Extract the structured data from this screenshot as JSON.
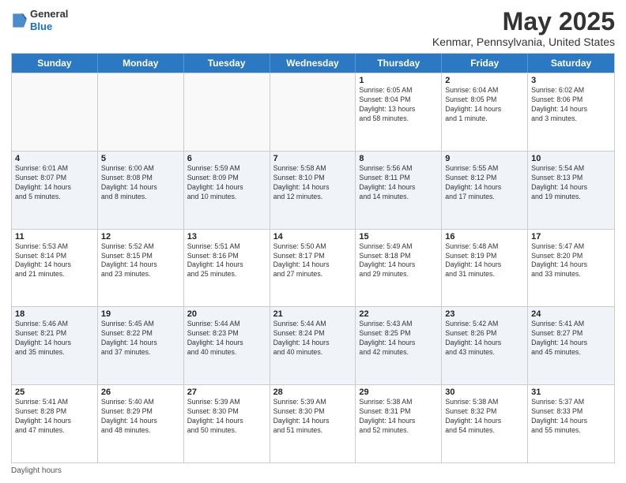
{
  "logo": {
    "general": "General",
    "blue": "Blue"
  },
  "title": "May 2025",
  "subtitle": "Kenmar, Pennsylvania, United States",
  "days": [
    "Sunday",
    "Monday",
    "Tuesday",
    "Wednesday",
    "Thursday",
    "Friday",
    "Saturday"
  ],
  "footer": "Daylight hours",
  "weeks": [
    [
      {
        "date": "",
        "info": ""
      },
      {
        "date": "",
        "info": ""
      },
      {
        "date": "",
        "info": ""
      },
      {
        "date": "",
        "info": ""
      },
      {
        "date": "1",
        "info": "Sunrise: 6:05 AM\nSunset: 8:04 PM\nDaylight: 13 hours\nand 58 minutes."
      },
      {
        "date": "2",
        "info": "Sunrise: 6:04 AM\nSunset: 8:05 PM\nDaylight: 14 hours\nand 1 minute."
      },
      {
        "date": "3",
        "info": "Sunrise: 6:02 AM\nSunset: 8:06 PM\nDaylight: 14 hours\nand 3 minutes."
      }
    ],
    [
      {
        "date": "4",
        "info": "Sunrise: 6:01 AM\nSunset: 8:07 PM\nDaylight: 14 hours\nand 5 minutes."
      },
      {
        "date": "5",
        "info": "Sunrise: 6:00 AM\nSunset: 8:08 PM\nDaylight: 14 hours\nand 8 minutes."
      },
      {
        "date": "6",
        "info": "Sunrise: 5:59 AM\nSunset: 8:09 PM\nDaylight: 14 hours\nand 10 minutes."
      },
      {
        "date": "7",
        "info": "Sunrise: 5:58 AM\nSunset: 8:10 PM\nDaylight: 14 hours\nand 12 minutes."
      },
      {
        "date": "8",
        "info": "Sunrise: 5:56 AM\nSunset: 8:11 PM\nDaylight: 14 hours\nand 14 minutes."
      },
      {
        "date": "9",
        "info": "Sunrise: 5:55 AM\nSunset: 8:12 PM\nDaylight: 14 hours\nand 17 minutes."
      },
      {
        "date": "10",
        "info": "Sunrise: 5:54 AM\nSunset: 8:13 PM\nDaylight: 14 hours\nand 19 minutes."
      }
    ],
    [
      {
        "date": "11",
        "info": "Sunrise: 5:53 AM\nSunset: 8:14 PM\nDaylight: 14 hours\nand 21 minutes."
      },
      {
        "date": "12",
        "info": "Sunrise: 5:52 AM\nSunset: 8:15 PM\nDaylight: 14 hours\nand 23 minutes."
      },
      {
        "date": "13",
        "info": "Sunrise: 5:51 AM\nSunset: 8:16 PM\nDaylight: 14 hours\nand 25 minutes."
      },
      {
        "date": "14",
        "info": "Sunrise: 5:50 AM\nSunset: 8:17 PM\nDaylight: 14 hours\nand 27 minutes."
      },
      {
        "date": "15",
        "info": "Sunrise: 5:49 AM\nSunset: 8:18 PM\nDaylight: 14 hours\nand 29 minutes."
      },
      {
        "date": "16",
        "info": "Sunrise: 5:48 AM\nSunset: 8:19 PM\nDaylight: 14 hours\nand 31 minutes."
      },
      {
        "date": "17",
        "info": "Sunrise: 5:47 AM\nSunset: 8:20 PM\nDaylight: 14 hours\nand 33 minutes."
      }
    ],
    [
      {
        "date": "18",
        "info": "Sunrise: 5:46 AM\nSunset: 8:21 PM\nDaylight: 14 hours\nand 35 minutes."
      },
      {
        "date": "19",
        "info": "Sunrise: 5:45 AM\nSunset: 8:22 PM\nDaylight: 14 hours\nand 37 minutes."
      },
      {
        "date": "20",
        "info": "Sunrise: 5:44 AM\nSunset: 8:23 PM\nDaylight: 14 hours\nand 40 minutes."
      },
      {
        "date": "21",
        "info": "Sunrise: 5:44 AM\nSunset: 8:24 PM\nDaylight: 14 hours\nand 40 minutes."
      },
      {
        "date": "22",
        "info": "Sunrise: 5:43 AM\nSunset: 8:25 PM\nDaylight: 14 hours\nand 42 minutes."
      },
      {
        "date": "23",
        "info": "Sunrise: 5:42 AM\nSunset: 8:26 PM\nDaylight: 14 hours\nand 43 minutes."
      },
      {
        "date": "24",
        "info": "Sunrise: 5:41 AM\nSunset: 8:27 PM\nDaylight: 14 hours\nand 45 minutes."
      }
    ],
    [
      {
        "date": "25",
        "info": "Sunrise: 5:41 AM\nSunset: 8:28 PM\nDaylight: 14 hours\nand 47 minutes."
      },
      {
        "date": "26",
        "info": "Sunrise: 5:40 AM\nSunset: 8:29 PM\nDaylight: 14 hours\nand 48 minutes."
      },
      {
        "date": "27",
        "info": "Sunrise: 5:39 AM\nSunset: 8:30 PM\nDaylight: 14 hours\nand 50 minutes."
      },
      {
        "date": "28",
        "info": "Sunrise: 5:39 AM\nSunset: 8:30 PM\nDaylight: 14 hours\nand 51 minutes."
      },
      {
        "date": "29",
        "info": "Sunrise: 5:38 AM\nSunset: 8:31 PM\nDaylight: 14 hours\nand 52 minutes."
      },
      {
        "date": "30",
        "info": "Sunrise: 5:38 AM\nSunset: 8:32 PM\nDaylight: 14 hours\nand 54 minutes."
      },
      {
        "date": "31",
        "info": "Sunrise: 5:37 AM\nSunset: 8:33 PM\nDaylight: 14 hours\nand 55 minutes."
      }
    ]
  ]
}
